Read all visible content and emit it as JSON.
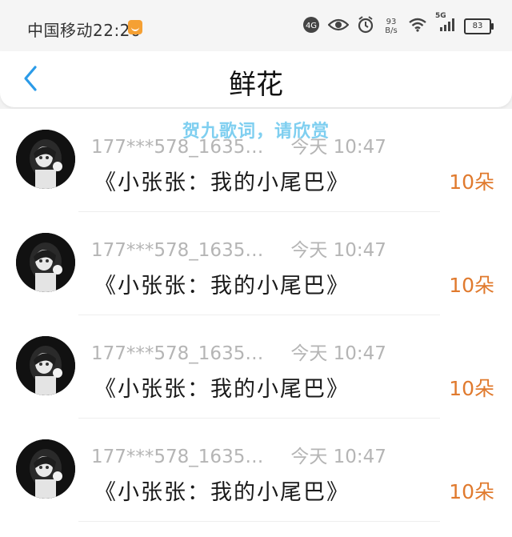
{
  "status_bar": {
    "carrier_time": "中国移动22:26",
    "net_speed_value": "93",
    "net_speed_unit": "B/s",
    "network_type": "5G",
    "battery_level": "83"
  },
  "header": {
    "title": "鲜花"
  },
  "watermark": "贺九歌词，请欣赏",
  "gifts": [
    {
      "sender": "177***578_1635…",
      "time": "今天 10:47",
      "note": "《小张张：我的小尾巴》",
      "amount": "10朵"
    },
    {
      "sender": "177***578_1635…",
      "time": "今天 10:47",
      "note": "《小张张：我的小尾巴》",
      "amount": "10朵"
    },
    {
      "sender": "177***578_1635…",
      "time": "今天 10:47",
      "note": "《小张张：我的小尾巴》",
      "amount": "10朵"
    },
    {
      "sender": "177***578_1635…",
      "time": "今天 10:47",
      "note": "《小张张：我的小尾巴》",
      "amount": "10朵"
    }
  ],
  "colors": {
    "accent_blue": "#2b9be8",
    "amount_orange": "#e07a2e",
    "meta_gray": "#b5b5b5"
  }
}
